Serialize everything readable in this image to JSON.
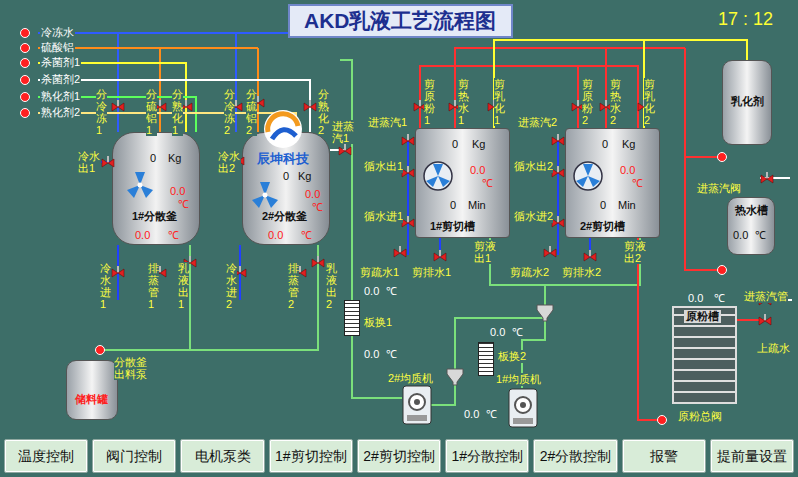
{
  "title": "AKD乳液工艺流程图",
  "clock": "17 : 12",
  "logo": "辰坤科技",
  "inlets": [
    {
      "label": "冷冻水",
      "color": "#2f5bff"
    },
    {
      "label": "硫酸铝",
      "color": "#ff8c1a"
    },
    {
      "label": "杀菌剂1",
      "color": "#ffff33"
    },
    {
      "label": "杀菌剂2",
      "color": "#ffffff"
    },
    {
      "label": "熟化剂1",
      "color": "#5cff5c"
    },
    {
      "label": "熟化剂2",
      "color": "#ffe680"
    }
  ],
  "vessels": [
    {
      "name": "1#分散釜",
      "kind": "kettle",
      "color": "#111111"
    },
    {
      "name": "2#分散釜",
      "kind": "kettle",
      "color": "#111111"
    },
    {
      "name": "1#剪切槽",
      "kind": "shear",
      "color": "#111111"
    },
    {
      "name": "2#剪切槽",
      "kind": "shear",
      "color": "#111111"
    },
    {
      "name": "乳化剂",
      "kind": "drum",
      "color": "#111111"
    },
    {
      "name": "热水槽",
      "kind": "drum",
      "color": "#111111"
    },
    {
      "name": "原粉槽",
      "kind": "bin",
      "color": "#111111"
    },
    {
      "name": "储料罐",
      "kind": "drum",
      "color": "#ff2020"
    }
  ],
  "labels": [
    "分冷冻1",
    "分硫铝1",
    "分熟化1",
    "冷水出1",
    "分冷冻2",
    "分硫铝2",
    "分熟化2",
    "冷水出2",
    "进蒸汽1",
    "冷水进1",
    "排蒸管1",
    "乳液出1",
    "冷水进2",
    "排蒸管2",
    "乳液出2",
    "剪原粉1",
    "剪热水1",
    "剪乳化1",
    "剪原粉2",
    "剪热水2",
    "剪乳化2",
    "进蒸汽1",
    "循水出1",
    "循水进1",
    "剪液出1",
    "剪疏水1",
    "剪排水1",
    "进蒸汽2",
    "循水出2",
    "循水进2",
    "剪液出2",
    "剪疏水2",
    "剪排水2",
    "进蒸汽阀",
    "进蒸汽管",
    "上疏水",
    "原粉总阀",
    "板换1",
    "板换2",
    "2#均质机",
    "1#均质机",
    "分散釜出料泵"
  ],
  "readings": [
    {
      "value": "0",
      "unit": "Kg",
      "color": "#111111"
    },
    {
      "value": "0.0",
      "unit": "℃",
      "color": "#ff2020"
    },
    {
      "value": "0.0",
      "unit": "℃",
      "color": "#ff2020"
    },
    {
      "value": "0",
      "unit": "Kg",
      "color": "#111111"
    },
    {
      "value": "0.0",
      "unit": "℃",
      "color": "#ff2020"
    },
    {
      "value": "0.0",
      "unit": "℃",
      "color": "#ff2020"
    },
    {
      "value": "0",
      "unit": "Kg",
      "color": "#111111"
    },
    {
      "value": "0.0",
      "unit": "℃",
      "color": "#ff2020"
    },
    {
      "value": "0",
      "unit": "Min",
      "color": "#111111"
    },
    {
      "value": "0",
      "unit": "Kg",
      "color": "#111111"
    },
    {
      "value": "0.0",
      "unit": "℃",
      "color": "#ff2020"
    },
    {
      "value": "0",
      "unit": "Min",
      "color": "#111111"
    },
    {
      "value": "0.0",
      "unit": "℃",
      "color": "#111111"
    },
    {
      "value": "0.0",
      "unit": "℃",
      "color": "#ffffff"
    },
    {
      "value": "0.0",
      "unit": "℃",
      "color": "#ffffff"
    },
    {
      "value": "0.0",
      "unit": "℃",
      "color": "#ffffff"
    },
    {
      "value": "0.0",
      "unit": "℃",
      "color": "#ffffff"
    },
    {
      "value": "0.0",
      "unit": "℃",
      "color": "#ffffff"
    }
  ],
  "buttons": [
    "温度控制",
    "阀门控制",
    "电机泵类",
    "1#剪切控制",
    "2#剪切控制",
    "1#分散控制",
    "2#分散控制",
    "报警",
    "提前量设置"
  ]
}
